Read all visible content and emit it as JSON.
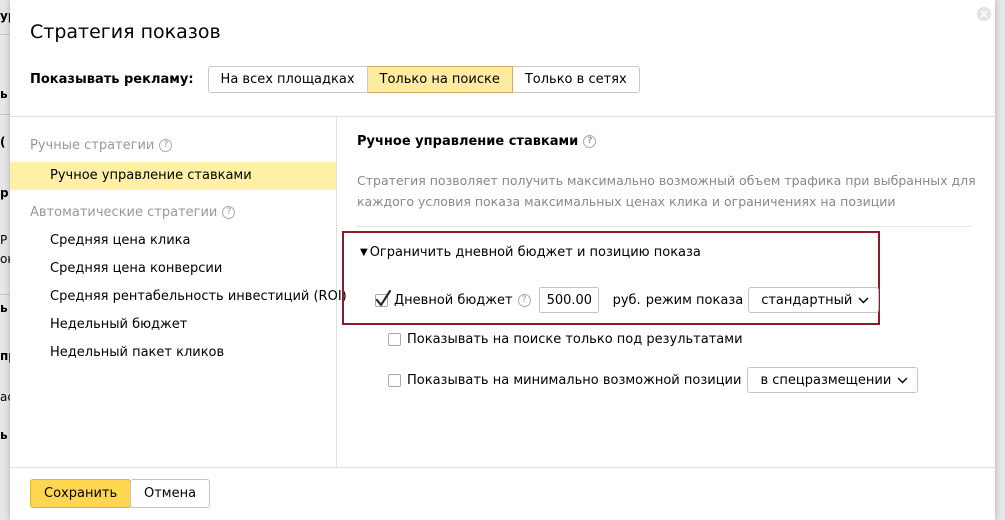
{
  "dialog": {
    "title": "Стратегия показов",
    "show_label": "Показывать рекламу:",
    "placements": [
      {
        "label": "На всех площадках",
        "active": false
      },
      {
        "label": "Только на поиске",
        "active": true
      },
      {
        "label": "Только в сетях",
        "active": false
      }
    ]
  },
  "sidebar": {
    "manual_title": "Ручные стратегии",
    "manual_items": [
      {
        "label": "Ручное управление ставками",
        "active": true
      }
    ],
    "auto_title": "Автоматические стратегии",
    "auto_items": [
      {
        "label": "Средняя цена клика"
      },
      {
        "label": "Средняя цена конверсии"
      },
      {
        "label": "Средняя рентабельность инвестиций (ROI)"
      },
      {
        "label": "Недельный бюджет"
      },
      {
        "label": "Недельный пакет кликов"
      }
    ]
  },
  "main": {
    "title": "Ручное управление ставками",
    "description": "Стратегия позволяет получить максимально возможный объем трафика при выбранных для каждого условия показа максимальных ценах клика и ограничениях на позиции",
    "budget_toggle": "Ограничить дневной бюджет и позицию показа",
    "daily_budget": {
      "label": "Дневной бюджет",
      "checked": true,
      "value": "500.00",
      "unit": "руб.",
      "mode_label": "режим показа",
      "mode_value": "стандартный"
    },
    "option_below_results": {
      "label": "Показывать на поиске только под результатами",
      "checked": false
    },
    "option_min_position": {
      "label": "Показывать на минимально возможной позиции",
      "checked": false,
      "select_value": "в спецразмещении"
    }
  },
  "footer": {
    "save_label": "Сохранить",
    "cancel_label": "Отмена"
  },
  "bg_fragments": [
    "ур",
    "ь",
    "(",
    "р",
    "Р",
    "ок",
    "ь",
    "пр",
    "ас",
    "ь"
  ],
  "icons": {
    "close": "close-icon",
    "help": "help-icon",
    "check": "checkmark-icon",
    "chevron": "chevron-down-icon",
    "triangle": "triangle-down-icon"
  },
  "colors": {
    "selected_bg": "#fff0a5",
    "placement_active_bg": "#ffeba0",
    "save_button_bg": "#ffd64f",
    "highlight_box_border": "#8b1a2b",
    "muted_text": "#999999"
  }
}
